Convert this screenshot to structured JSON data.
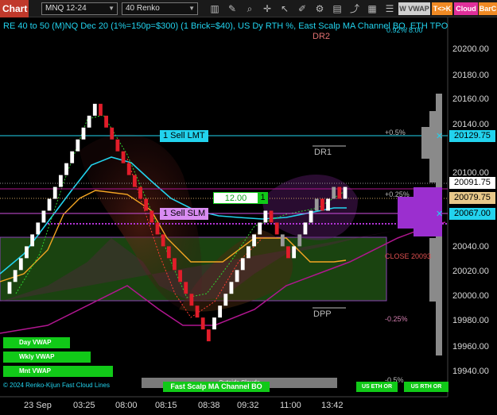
{
  "toolbar": {
    "chart_label": "Chart",
    "instrument": "MNQ 12-24",
    "bar_type": "40 Renko",
    "wvwap_label": "W VWAP",
    "tk_label": "T<>K",
    "cloud_label": "Cloud",
    "barc_label": "BarC"
  },
  "chart": {
    "title": "RE 40 to 50 (M)NQ Dec 20 (1%=150p=$300) (1 Brick=$40), US Dy RTH %, East Scalp MA Channel BO, ETH TPO",
    "dr2": "DR2",
    "dr1": "DR1",
    "dpp": "DPP",
    "pct_top": "0.92% 8.00",
    "pct_05": "+0.5%",
    "pct_025": "+0.25%",
    "pct_m025": "-0.25%",
    "pct_m05": "-0.5%",
    "close_label": "CLOSE 20093",
    "outside_clouds": "Outside Clouds",
    "copyright": "© 2024 Renko-Kijun Fast Cloud Lines",
    "fast_scalp": "Fast Scalp MA Channel BO",
    "us_eth_or": "US ETH OR",
    "us_rth_or": "US RTH OR",
    "day_vwap": "Day VWAP",
    "wkly_vwap": "Wkly VWAP",
    "mnt_vwap": "Mnt VWAP",
    "qty": "12.00",
    "qty_badge": "1",
    "sell_lmt": "1 Sell LMT",
    "sell_slm": "1 Sell SLM",
    "price_sell_lmt": "20129.75",
    "price_last": "20091.75",
    "price_close": "20079.75",
    "price_slm": "20067.00",
    "y_ticks": [
      "20200.00",
      "20180.00",
      "20160.00",
      "20140.00",
      "20100.00",
      "20040.00",
      "20020.00",
      "20000.00",
      "19980.00",
      "19960.00",
      "19940.00"
    ],
    "x_ticks": [
      "23 Sep",
      "03:25",
      "08:00",
      "08:15",
      "08:38",
      "09:32",
      "11:00",
      "13:42"
    ]
  },
  "chart_data": {
    "type": "candlestick",
    "brick_size": 10,
    "ylim": [
      19930,
      20215
    ],
    "bricks": [
      {
        "open": 20000,
        "close": 20010
      },
      {
        "open": 20010,
        "close": 20020
      },
      {
        "open": 20020,
        "close": 20030
      },
      {
        "open": 20030,
        "close": 20040
      },
      {
        "open": 20040,
        "close": 20050
      },
      {
        "open": 20050,
        "close": 20060
      },
      {
        "open": 20060,
        "close": 20070
      },
      {
        "open": 20070,
        "close": 20080
      },
      {
        "open": 20080,
        "close": 20090
      },
      {
        "open": 20090,
        "close": 20100
      },
      {
        "open": 20100,
        "close": 20110
      },
      {
        "open": 20110,
        "close": 20120
      },
      {
        "open": 20120,
        "close": 20130
      },
      {
        "open": 20130,
        "close": 20140
      },
      {
        "open": 20140,
        "close": 20150
      },
      {
        "open": 20150,
        "close": 20160
      },
      {
        "open": 20160,
        "close": 20150
      },
      {
        "open": 20150,
        "close": 20140
      },
      {
        "open": 20140,
        "close": 20130
      },
      {
        "open": 20130,
        "close": 20120
      },
      {
        "open": 20120,
        "close": 20110
      },
      {
        "open": 20110,
        "close": 20100
      },
      {
        "open": 20100,
        "close": 20090
      },
      {
        "open": 20090,
        "close": 20080
      },
      {
        "open": 20080,
        "close": 20070
      },
      {
        "open": 20070,
        "close": 20060
      },
      {
        "open": 20060,
        "close": 20050
      },
      {
        "open": 20050,
        "close": 20040
      },
      {
        "open": 20040,
        "close": 20030
      },
      {
        "open": 20030,
        "close": 20020
      },
      {
        "open": 20020,
        "close": 20010
      },
      {
        "open": 20010,
        "close": 20000
      },
      {
        "open": 20000,
        "close": 19990
      },
      {
        "open": 19990,
        "close": 19980
      },
      {
        "open": 19980,
        "close": 19970
      },
      {
        "open": 19970,
        "close": 19960
      },
      {
        "open": 19970,
        "close": 19980
      },
      {
        "open": 19980,
        "close": 19990
      },
      {
        "open": 19990,
        "close": 20000
      },
      {
        "open": 20000,
        "close": 20010
      },
      {
        "open": 20010,
        "close": 20020
      },
      {
        "open": 20020,
        "close": 20030
      },
      {
        "open": 20030,
        "close": 20040
      },
      {
        "open": 20040,
        "close": 20050
      },
      {
        "open": 20050,
        "close": 20060
      },
      {
        "open": 20060,
        "close": 20070
      },
      {
        "open": 20070,
        "close": 20060
      },
      {
        "open": 20060,
        "close": 20050
      },
      {
        "open": 20050,
        "close": 20040
      },
      {
        "open": 20040,
        "close": 20030
      },
      {
        "open": 20030,
        "close": 20040
      },
      {
        "open": 20040,
        "close": 20050
      },
      {
        "open": 20050,
        "close": 20060
      },
      {
        "open": 20060,
        "close": 20070
      },
      {
        "open": 20070,
        "close": 20080
      },
      {
        "open": 20080,
        "close": 20070
      },
      {
        "open": 20070,
        "close": 20080
      },
      {
        "open": 20080,
        "close": 20090
      },
      {
        "open": 20090,
        "close": 20080
      },
      {
        "open": 20080,
        "close": 20090
      }
    ],
    "colors": {
      "up": "#ffffff",
      "down": "#e11d2a",
      "neutral": "#9a9a9a",
      "kijun": "#22d3ee",
      "channel": "#f5a623",
      "bollinger": "#b0168f"
    }
  }
}
